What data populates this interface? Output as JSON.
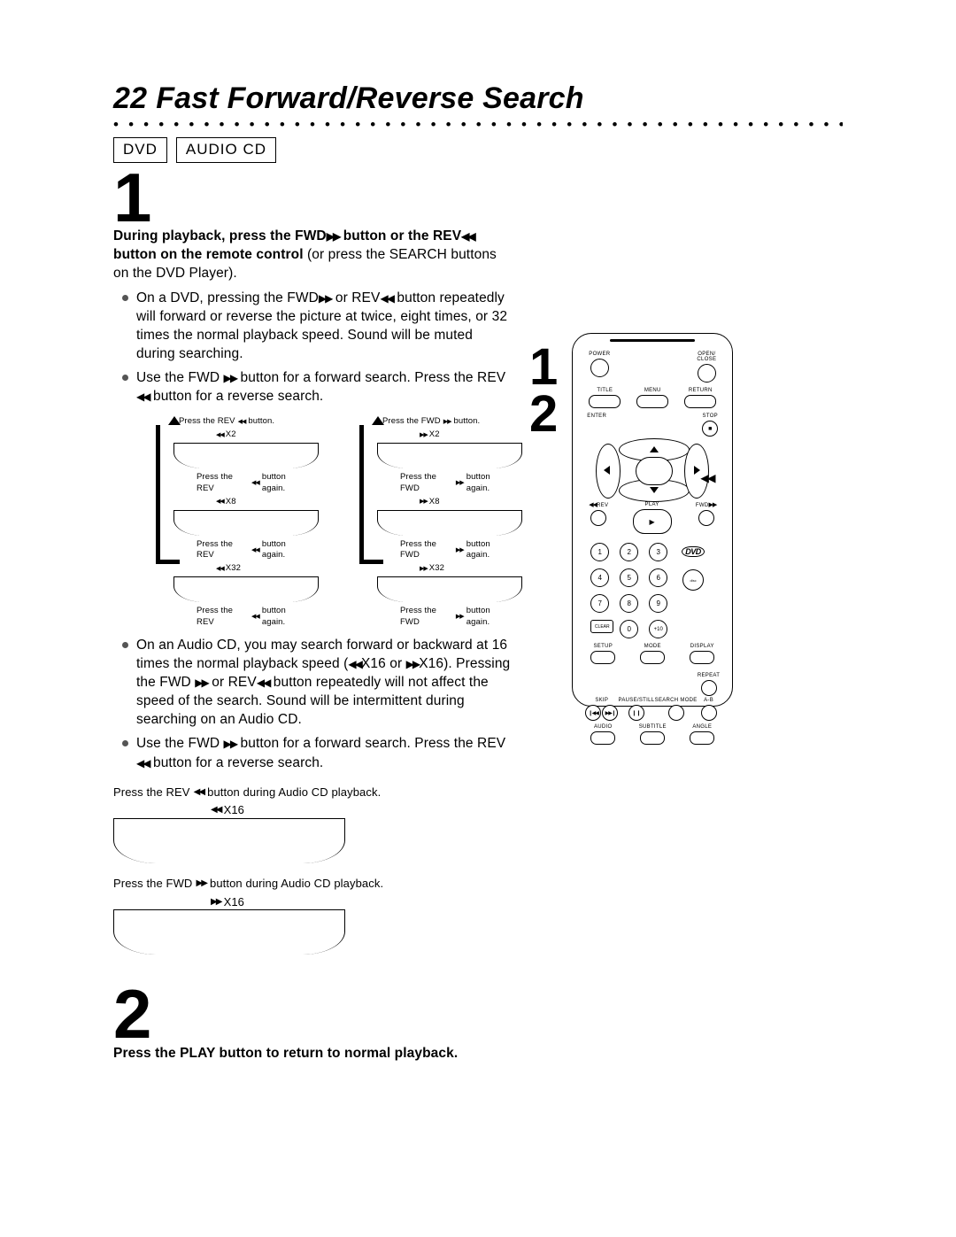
{
  "page_number": "22",
  "page_title": "Fast Forward/Reverse Search",
  "tags": {
    "dvd": "DVD",
    "audiocd": "AUDIO CD"
  },
  "step1": {
    "num": "1",
    "lead_bold": "During playback, press the FWD",
    "lead_bold2": " button or the REV",
    "lead_plain": "button on the remote control",
    "lead_plain2": " (or press the SEARCH buttons on the DVD Player).",
    "bul1": "On a DVD, pressing the FWD",
    "bul1b": " or REV",
    "bul1c": " button repeatedly will forward or reverse the picture at twice, eight times, or 32 times the normal playback speed. Sound will be muted during searching.",
    "bul2a": "Use the FWD ",
    "bul2b": " button for a forward search. Press the REV",
    "bul2c": " button for a reverse search.",
    "bul3a": "On an Audio CD, you may search forward or backward at 16 times the normal playback speed (",
    "bul3b": "X16 or ",
    "bul3c": "X16). Pressing the FWD ",
    "bul3d": " or REV",
    "bul3e": " button repeatedly will not affect the speed of the search. Sound will be intermittent during searching on an Audio CD.",
    "bul4a": "Use the FWD ",
    "bul4b": " button for a forward search. Press the REV",
    "bul4c": " button for a reverse search."
  },
  "fig_rev": {
    "c1": "Press the REV ",
    "c1b": " button.",
    "s1": "X2",
    "c2": "Press the REV ",
    "c2b": " button again.",
    "s2": "X8",
    "c3": "Press the REV ",
    "c3b": " button again.",
    "s3": "X32",
    "c4": "Press the REV ",
    "c4b": " button again."
  },
  "fig_fwd": {
    "c1": "Press the FWD ",
    "c1b": " button.",
    "s1": "X2",
    "c2": "Press the FWD ",
    "c2b": " button again.",
    "s2": "X8",
    "c3": "Press the FWD ",
    "c3b": " button again.",
    "s3": "X32",
    "c4": "Press the FWD ",
    "c4b": " button again."
  },
  "cd_fig": {
    "cap_rev_a": "Press the REV ",
    "cap_rev_b": " button during Audio CD playback.",
    "sp_rev": "X16",
    "cap_fwd_a": "Press the FWD",
    "cap_fwd_b": " button during Audio CD playback.",
    "sp_fwd": "X16"
  },
  "step2": {
    "num": "2",
    "text": "Press the PLAY button to return to normal playback."
  },
  "side": {
    "n1": "1",
    "n2": "2"
  },
  "remote": {
    "power": "POWER",
    "open": "OPEN/\nCLOSE",
    "title": "TITLE",
    "menu": "MENU",
    "return": "RETURN",
    "enter": "ENTER",
    "stop": "STOP",
    "rev": "REV",
    "play": "PLAY",
    "fwd": "FWD",
    "nums": [
      "1",
      "2",
      "3",
      "4",
      "5",
      "6",
      "7",
      "8",
      "9",
      "0"
    ],
    "clear": "CLEAR",
    "plus10": "+10",
    "setup": "SETUP",
    "mode": "MODE",
    "display": "DISPLAY",
    "skip": "SKIP",
    "pause": "PAUSE/STILL",
    "search": "SEARCH MODE",
    "repeat": "REPEAT",
    "ab": "A-B",
    "audio": "AUDIO",
    "subtitle": "SUBTITLE",
    "angle": "ANGLE",
    "dvd": "DVD"
  }
}
